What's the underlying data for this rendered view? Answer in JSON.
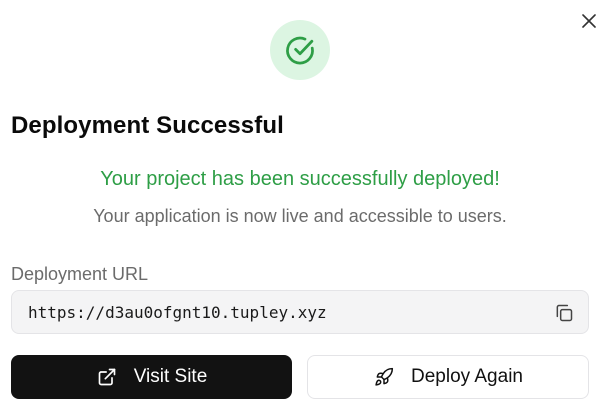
{
  "dialog": {
    "title": "Deployment Successful",
    "success_message": "Your project has been successfully deployed!",
    "sub_message": "Your application is now live and accessible to users.",
    "url_label": "Deployment URL",
    "url_value": "https://d3au0ofgnt10.tupley.xyz",
    "icons": {
      "close": "close-icon",
      "success": "check-circle-icon",
      "copy": "copy-icon",
      "visit": "external-link-icon",
      "deploy": "rocket-icon"
    }
  },
  "actions": {
    "visit_label": "Visit Site",
    "deploy_again_label": "Deploy Again"
  },
  "colors": {
    "success_green": "#2e9e46",
    "success_bg": "#dcf5e2",
    "primary_button": "#121212",
    "muted_text": "#6b6b6b"
  }
}
